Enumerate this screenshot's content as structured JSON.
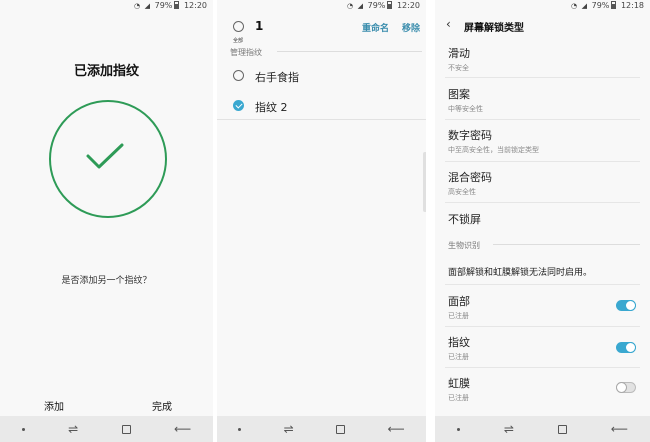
{
  "status_bar": {
    "screen1": {
      "battery": "79%",
      "time": "12:20"
    },
    "screen2": {
      "battery": "79%",
      "time": "12:20"
    },
    "screen3": {
      "battery": "79%",
      "time": "12:18"
    }
  },
  "screen1": {
    "title": "已添加指纹",
    "question": "是否添加另一个指纹？",
    "add_label": "添加",
    "done_label": "完成"
  },
  "screen2": {
    "select_all_label": "全部",
    "selected_count": "1",
    "rename_label": "重命名",
    "remove_label": "移除",
    "section_header": "管理指纹",
    "fingerprints": [
      {
        "label": "右手食指",
        "checked": false
      },
      {
        "label": "指纹 2",
        "checked": true
      }
    ]
  },
  "screen3": {
    "title": "屏幕解锁类型",
    "lock_types": [
      {
        "title": "滑动",
        "subtitle": "不安全"
      },
      {
        "title": "图案",
        "subtitle": "中等安全性"
      },
      {
        "title": "数字密码",
        "subtitle": "中至高安全性，当前锁定类型"
      },
      {
        "title": "混合密码",
        "subtitle": "高安全性"
      },
      {
        "title": "不锁屏",
        "subtitle": ""
      }
    ],
    "biometrics_header": "生物识别",
    "biometrics_note": "面部解锁和虹膜解锁无法同时启用。",
    "biometrics": [
      {
        "title": "面部",
        "subtitle": "已注册",
        "enabled": true
      },
      {
        "title": "指纹",
        "subtitle": "已注册",
        "enabled": true
      },
      {
        "title": "虹膜",
        "subtitle": "已注册",
        "enabled": false
      }
    ]
  },
  "icons": {
    "check": "check-icon",
    "back": "back-arrow-icon",
    "recents": "recents-icon",
    "home": "home-icon",
    "nav_back": "nav-back-icon"
  },
  "colors": {
    "success_green": "#2e9b57",
    "accent_blue": "#3aa8d0",
    "action_text_blue": "#3a8dad"
  }
}
